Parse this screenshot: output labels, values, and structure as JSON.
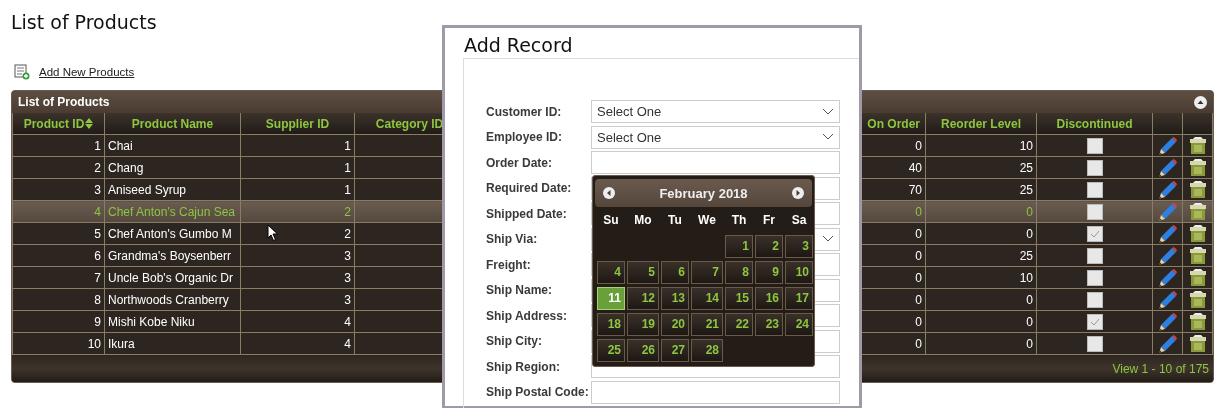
{
  "page": {
    "title": "List of Products",
    "add_link": "Add New Products"
  },
  "grid": {
    "caption": "List of Products",
    "columns_left": [
      {
        "label": "Product ID",
        "sorted": true
      },
      {
        "label": "Product Name",
        "sorted": false
      },
      {
        "label": "Supplier ID",
        "sorted": false
      },
      {
        "label": "Category ID",
        "sorted": false
      }
    ],
    "columns_right": [
      {
        "label": "On Order",
        "sorted": false
      },
      {
        "label": "Reorder Level",
        "sorted": false
      },
      {
        "label": "Discontinued",
        "sorted": false
      }
    ],
    "rows": [
      {
        "id": "1",
        "name": "Chai",
        "supplier": "1",
        "on_order": "0",
        "reorder": "10",
        "discontinued": false,
        "highlighted": false
      },
      {
        "id": "2",
        "name": "Chang",
        "supplier": "1",
        "on_order": "40",
        "reorder": "25",
        "discontinued": false,
        "highlighted": false
      },
      {
        "id": "3",
        "name": "Aniseed Syrup",
        "supplier": "1",
        "on_order": "70",
        "reorder": "25",
        "discontinued": false,
        "highlighted": false
      },
      {
        "id": "4",
        "name": "Chef Anton's Cajun Sea",
        "supplier": "2",
        "on_order": "0",
        "reorder": "0",
        "discontinued": false,
        "highlighted": true
      },
      {
        "id": "5",
        "name": "Chef Anton's Gumbo M",
        "supplier": "2",
        "on_order": "0",
        "reorder": "0",
        "discontinued": true,
        "highlighted": false
      },
      {
        "id": "6",
        "name": "Grandma's Boysenberr",
        "supplier": "3",
        "on_order": "0",
        "reorder": "25",
        "discontinued": false,
        "highlighted": false
      },
      {
        "id": "7",
        "name": "Uncle Bob's Organic Dr",
        "supplier": "3",
        "on_order": "0",
        "reorder": "10",
        "discontinued": false,
        "highlighted": false
      },
      {
        "id": "8",
        "name": "Northwoods Cranberry",
        "supplier": "3",
        "on_order": "0",
        "reorder": "0",
        "discontinued": false,
        "highlighted": false
      },
      {
        "id": "9",
        "name": "Mishi Kobe Niku",
        "supplier": "4",
        "on_order": "0",
        "reorder": "0",
        "discontinued": true,
        "highlighted": false
      },
      {
        "id": "10",
        "name": "Ikura",
        "supplier": "4",
        "on_order": "0",
        "reorder": "0",
        "discontinued": false,
        "highlighted": false
      }
    ],
    "pager": "View 1 - 10 of 175"
  },
  "dialog": {
    "title": "Add Record",
    "fields": [
      {
        "label": "Customer ID:",
        "kind": "select",
        "value": "Select One"
      },
      {
        "label": "Employee ID:",
        "kind": "select",
        "value": "Select One"
      },
      {
        "label": "Order Date:",
        "kind": "text"
      },
      {
        "label": "Required Date:",
        "kind": "text"
      },
      {
        "label": "Shipped Date:",
        "kind": "text"
      },
      {
        "label": "Ship Via:",
        "kind": "select"
      },
      {
        "label": "Freight:",
        "kind": "text"
      },
      {
        "label": "Ship Name:",
        "kind": "text"
      },
      {
        "label": "Ship Address:",
        "kind": "text"
      },
      {
        "label": "Ship City:",
        "kind": "text"
      },
      {
        "label": "Ship Region:",
        "kind": "text"
      },
      {
        "label": "Ship Postal Code:",
        "kind": "text"
      }
    ]
  },
  "calendar": {
    "month": "February 2018",
    "weekdays": [
      "Su",
      "Mo",
      "Tu",
      "We",
      "Th",
      "Fr",
      "Sa"
    ],
    "weeks": [
      [
        {
          "day": "1",
          "selected": false
        },
        {
          "day": "2",
          "selected": false
        },
        {
          "day": "3",
          "selected": false
        }
      ],
      [
        {
          "day": "4",
          "selected": false
        },
        {
          "day": "5",
          "selected": false
        },
        {
          "day": "6",
          "selected": false
        },
        {
          "day": "7",
          "selected": false
        },
        {
          "day": "8",
          "selected": false
        },
        {
          "day": "9",
          "selected": false
        },
        {
          "day": "10",
          "selected": false
        }
      ],
      [
        {
          "day": "11",
          "selected": true
        },
        {
          "day": "12",
          "selected": false
        },
        {
          "day": "13",
          "selected": false
        },
        {
          "day": "14",
          "selected": false
        },
        {
          "day": "15",
          "selected": false
        },
        {
          "day": "16",
          "selected": false
        },
        {
          "day": "17",
          "selected": false
        }
      ],
      [
        {
          "day": "18",
          "selected": false
        },
        {
          "day": "19",
          "selected": false
        },
        {
          "day": "20",
          "selected": false
        },
        {
          "day": "21",
          "selected": false
        },
        {
          "day": "22",
          "selected": false
        },
        {
          "day": "23",
          "selected": false
        },
        {
          "day": "24",
          "selected": false
        }
      ],
      [
        {
          "day": "25",
          "selected": false
        },
        {
          "day": "26",
          "selected": false
        },
        {
          "day": "27",
          "selected": false
        },
        {
          "day": "28",
          "selected": false
        }
      ]
    ]
  }
}
